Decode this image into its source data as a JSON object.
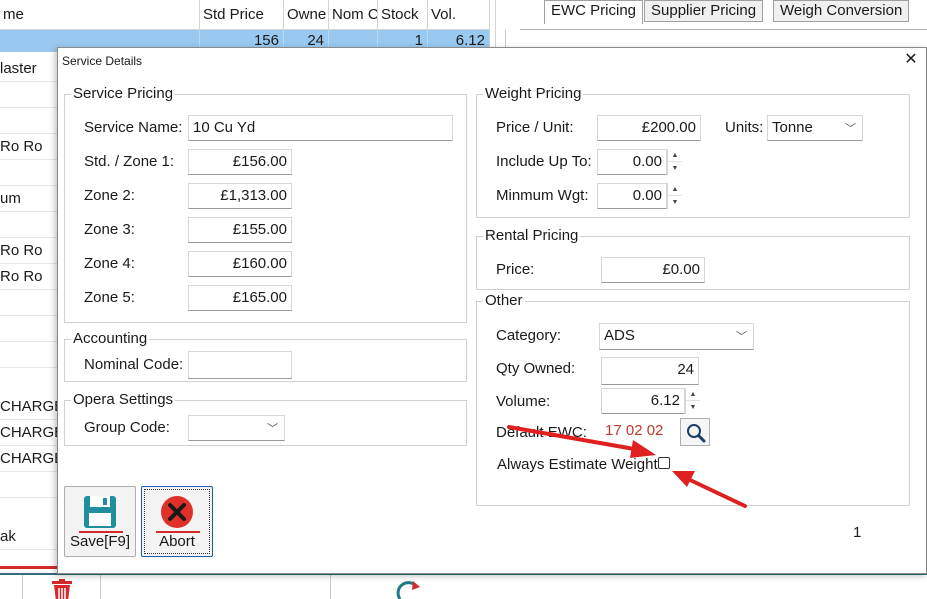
{
  "background": {
    "grid_headers": [
      "me",
      "Std Price",
      "Owne",
      "Nom C",
      "Stock",
      "Vol."
    ],
    "selected_row": [
      "",
      "156",
      "24",
      "",
      "1",
      "6.12"
    ],
    "left_column_rows": [
      "laster",
      "",
      "",
      "Ro Ro",
      "",
      "um",
      "",
      "Ro Ro",
      "Ro Ro",
      "",
      "",
      "",
      "CHARGE",
      "CHARGE",
      "CHARGE",
      "",
      "ak"
    ],
    "right_tabs": [
      "EWC Pricing",
      "Supplier Pricing",
      "Weigh Conversion"
    ]
  },
  "dialog": {
    "title": "Service Details",
    "close_glyph": "✕",
    "service_pricing": {
      "title": "Service Pricing",
      "service_name_label": "Service Name:",
      "service_name_value": "10 Cu Yd",
      "std_zone1_label": "Std. / Zone 1:",
      "std_zone1_value": "£156.00",
      "zone2_label": "Zone 2:",
      "zone2_value": "£1,313.00",
      "zone3_label": "Zone 3:",
      "zone3_value": "£155.00",
      "zone4_label": "Zone 4:",
      "zone4_value": "£160.00",
      "zone5_label": "Zone 5:",
      "zone5_value": "£165.00"
    },
    "accounting": {
      "title": "Accounting",
      "nominal_code_label": "Nominal Code:",
      "nominal_code_value": ""
    },
    "opera_settings": {
      "title": "Opera Settings",
      "group_code_label": "Group Code:",
      "group_code_value": ""
    },
    "weight_pricing": {
      "title": "Weight Pricing",
      "price_unit_label": "Price / Unit:",
      "price_unit_value": "£200.00",
      "units_label": "Units:",
      "units_value": "Tonne",
      "include_up_to_label": "Include Up To:",
      "include_up_to_value": "0.00",
      "min_weight_label": "Minmum Wgt:",
      "min_weight_value": "0.00"
    },
    "rental_pricing": {
      "title": "Rental Pricing",
      "price_label": "Price:",
      "price_value": "£0.00"
    },
    "other": {
      "title": "Other",
      "category_label": "Category:",
      "category_value": "ADS",
      "qty_owned_label": "Qty Owned:",
      "qty_owned_value": "24",
      "volume_label": "Volume:",
      "volume_value": "6.12",
      "default_ewc_label": "Default EWC:",
      "default_ewc_value": "17 02 02",
      "always_estimate_label": "Always Estimate Weight",
      "always_estimate_checked": false
    },
    "buttons": {
      "save_label": "Save[F9]",
      "abort_label": "Abort"
    },
    "page_number": "1"
  },
  "colors": {
    "selection": "#99c9ef",
    "annotation_arrow": "#e02020",
    "save_icon": "#1f8fa0",
    "abort_icon": "#e0302a",
    "ewc_text": "#c0392b"
  }
}
